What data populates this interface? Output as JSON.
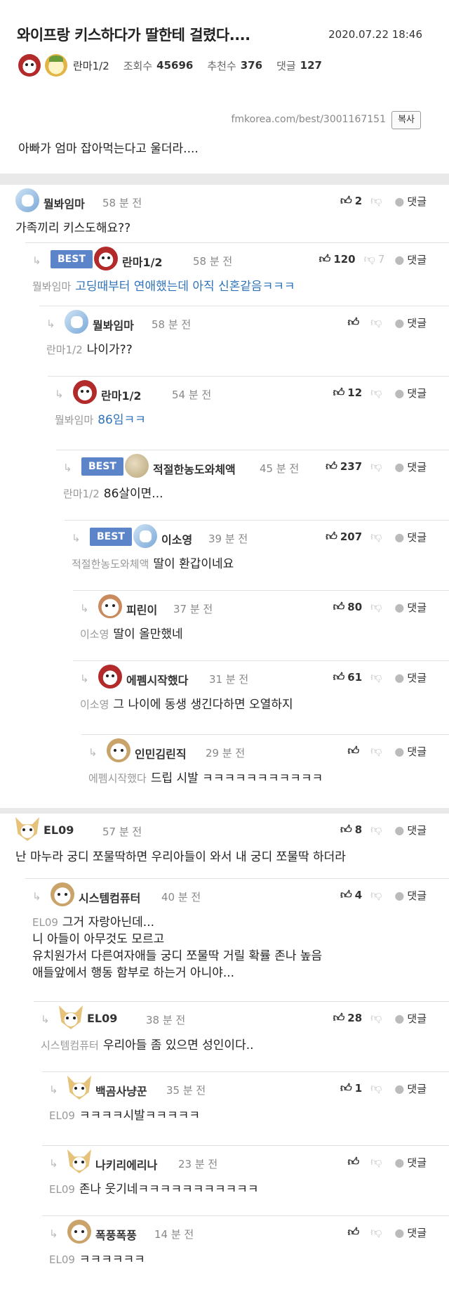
{
  "post": {
    "title": "와이프랑 키스하다가 딸한테 걸렸다....",
    "date": "2020.07.22 18:46",
    "author": "란마1/2",
    "views_label": "조회수",
    "views": "45696",
    "recommend_label": "추천수",
    "recommend": "376",
    "comments_label": "댓글",
    "comments": "127",
    "url": "fmkorea.com/best/3001167151",
    "copy_label": "복사",
    "body": "아빠가 엄마 잡아먹는다고 울더라...."
  },
  "ui": {
    "reply_label": "댓글",
    "best_label": "BEST"
  },
  "comments": [
    {
      "nick": "뭘봐임마",
      "time": "58 분 전",
      "up": "2",
      "down": "",
      "mention": "",
      "text": "가족끼리 키스도해요??",
      "best": false,
      "avatar": "blue-icon"
    },
    {
      "nick": "란마1/2",
      "time": "58 분 전",
      "up": "120",
      "down": "7",
      "mention": "뭘봐임마",
      "text": "고딩때부터 연애했는데 아직 신혼같음ㅋㅋㅋ",
      "best": true,
      "avatar": "red-dog-icon"
    },
    {
      "nick": "뭘봐임마",
      "time": "58 분 전",
      "up": "",
      "down": "",
      "mention": "란마1/2",
      "text": "나이가??",
      "best": false,
      "avatar": "blue-icon"
    },
    {
      "nick": "란마1/2",
      "time": "54 분 전",
      "up": "12",
      "down": "",
      "mention": "뭘봐임마",
      "text": "86임ㅋㅋ",
      "best": false,
      "avatar": "red-dog-icon"
    },
    {
      "nick": "적절한농도와체액",
      "time": "45 분 전",
      "up": "237",
      "down": "",
      "mention": "란마1/2",
      "text": "86살이면...",
      "best": true,
      "avatar": "potato-icon"
    },
    {
      "nick": "이소영",
      "time": "39 분 전",
      "up": "207",
      "down": "",
      "mention": "적절한농도와체액",
      "text": "딸이 환갑이네요",
      "best": true,
      "avatar": "blue-icon"
    },
    {
      "nick": "피린이",
      "time": "37 분 전",
      "up": "80",
      "down": "",
      "mention": "이소영",
      "text": "딸이 올만했네",
      "best": false,
      "avatar": "dog-icon"
    },
    {
      "nick": "에펨시작했다",
      "time": "31 분 전",
      "up": "61",
      "down": "",
      "mention": "이소영",
      "text": "그 나이에 동생 생긴다하면 오열하지",
      "best": false,
      "avatar": "red-dog-icon"
    },
    {
      "nick": "인민김린직",
      "time": "29 분 전",
      "up": "",
      "down": "",
      "mention": "에펨시작했다",
      "text": "드립 시발 ㅋㅋㅋㅋㅋㅋㅋㅋㅋㅋㅋ",
      "best": false,
      "avatar": "bear-icon"
    },
    {
      "nick": "EL09",
      "time": "57 분 전",
      "up": "8",
      "down": "",
      "mention": "",
      "text": "난 마누라 궁디 쪼물딱하면 우리아들이 와서 내 궁디 쪼물딱 하더라",
      "best": false,
      "avatar": "fox-icon"
    },
    {
      "nick": "시스템컴퓨터",
      "time": "40 분 전",
      "up": "4",
      "down": "",
      "mention": "EL09",
      "text": "그거 자랑아닌데...",
      "text2": "니 아들이 아무것도 모르고",
      "text3": "유치원가서 다른여자애들 궁디 쪼물딱 거릴 확률 존나 높음",
      "text4": "애들앞에서 행동 함부로 하는거 아니야...",
      "best": false,
      "avatar": "bear-icon"
    },
    {
      "nick": "EL09",
      "time": "38 분 전",
      "up": "28",
      "down": "",
      "mention": "시스템컴퓨터",
      "text": "우리아들 좀 있으면 성인이다..",
      "best": false,
      "avatar": "fox-icon"
    },
    {
      "nick": "백곰사냥꾼",
      "time": "35 분 전",
      "up": "1",
      "down": "",
      "mention": "EL09",
      "text": "ㅋㅋㅋㅋ시발ㅋㅋㅋㅋㅋ",
      "best": false,
      "avatar": "fox-icon"
    },
    {
      "nick": "나키리에리나",
      "time": "23 분 전",
      "up": "",
      "down": "",
      "mention": "EL09",
      "text": "존나 웃기네ㅋㅋㅋㅋㅋㅋㅋㅋㅋㅋㅋ",
      "best": false,
      "avatar": "fox-icon"
    },
    {
      "nick": "폭풍폭풍",
      "time": "14 분 전",
      "up": "",
      "down": "",
      "mention": "EL09",
      "text": "ㅋㅋㅋㅋㅋㅋ",
      "best": false,
      "avatar": "bear-icon"
    }
  ]
}
